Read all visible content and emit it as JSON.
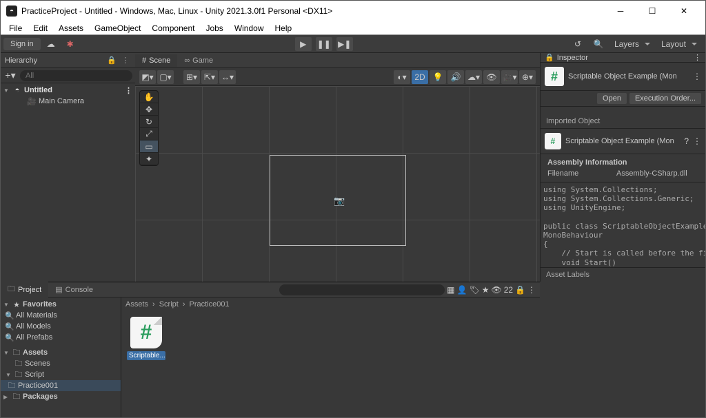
{
  "window": {
    "title": "PracticeProject - Untitled - Windows, Mac, Linux - Unity 2021.3.0f1 Personal <DX11>"
  },
  "menu": [
    "File",
    "Edit",
    "Assets",
    "GameObject",
    "Component",
    "Jobs",
    "Window",
    "Help"
  ],
  "topbar": {
    "signin": "Sign in",
    "layers": "Layers",
    "layout": "Layout"
  },
  "hierarchy": {
    "title": "Hierarchy",
    "search_placeholder": "All",
    "scene": "Untitled",
    "objects": [
      "Main Camera"
    ]
  },
  "scene_tabs": {
    "scene": "Scene",
    "game": "Game"
  },
  "scene_toolbar": {
    "mode_2d": "2D"
  },
  "project": {
    "tab_project": "Project",
    "tab_console": "Console",
    "hidden_count": "22",
    "favorites": {
      "label": "Favorites",
      "items": [
        "All Materials",
        "All Models",
        "All Prefabs"
      ]
    },
    "assets_label": "Assets",
    "assets_tree": [
      {
        "name": "Scenes",
        "children": []
      },
      {
        "name": "Script",
        "children": [
          "Practice001"
        ]
      }
    ],
    "packages_label": "Packages",
    "breadcrumb": [
      "Assets",
      "Script",
      "Practice001"
    ],
    "grid_items": [
      {
        "label": "Scriptable..."
      }
    ]
  },
  "inspector": {
    "title": "Inspector",
    "object_name": "Scriptable Object Example (Mon",
    "open_btn": "Open",
    "exec_btn": "Execution Order...",
    "imported_label": "Imported Object",
    "imported_name": "Scriptable Object Example (Mon",
    "assembly_header": "Assembly Information",
    "assembly_filename_k": "Filename",
    "assembly_filename_v": "Assembly-CSharp.dll",
    "code": "using System.Collections;\nusing System.Collections.Generic;\nusing UnityEngine;\n\npublic class ScriptableObjectExample :\nMonoBehaviour\n{\n    // Start is called before the first frame update\n    void Start()\n    {\n\n    }\n\n    // Update is called once per frame\n    void Update()\n    {\n\n    }\n}",
    "footer": "Asset Labels"
  }
}
